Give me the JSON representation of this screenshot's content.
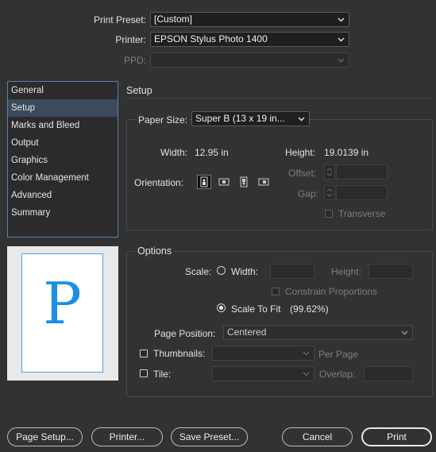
{
  "header": {
    "print_preset_label": "Print Preset:",
    "print_preset_value": "[Custom]",
    "printer_label": "Printer:",
    "printer_value": "EPSON Stylus Photo 1400",
    "ppd_label": "PPD:",
    "ppd_value": ""
  },
  "sidebar": {
    "items": [
      {
        "label": "General"
      },
      {
        "label": "Setup"
      },
      {
        "label": "Marks and Bleed"
      },
      {
        "label": "Output"
      },
      {
        "label": "Graphics"
      },
      {
        "label": "Color Management"
      },
      {
        "label": "Advanced"
      },
      {
        "label": "Summary"
      }
    ],
    "selected": "Setup"
  },
  "preview": {
    "letter": "P",
    "accent": "#1a8fe3"
  },
  "setup": {
    "title": "Setup",
    "paper_size_label": "Paper Size:",
    "paper_size_value": "Super B (13 x 19 in...",
    "width_label": "Width:",
    "width_value": "12.95 in",
    "height_label": "Height:",
    "height_value": "19.0139 in",
    "orientation_label": "Orientation:",
    "orientation_icons": [
      "portrait-icon",
      "landscape-icon",
      "reverse-portrait-icon",
      "reverse-landscape-icon"
    ],
    "offset_label": "Offset:",
    "gap_label": "Gap:",
    "transverse_label": "Transverse"
  },
  "options": {
    "title": "Options",
    "scale_label": "Scale:",
    "width_label": "Width:",
    "height_label": "Height:",
    "constrain_label": "Constrain Proportions",
    "scale_to_fit_label": "Scale To Fit",
    "scale_to_fit_value": "(99.62%)",
    "page_position_label": "Page Position:",
    "page_position_value": "Centered",
    "thumbnails_label": "Thumbnails:",
    "per_page_label": "Per Page",
    "tile_label": "Tile:",
    "overlap_label": "Overlap:"
  },
  "buttons": {
    "page_setup": "Page Setup...",
    "printer": "Printer...",
    "save_preset": "Save Preset...",
    "cancel": "Cancel",
    "print": "Print"
  }
}
